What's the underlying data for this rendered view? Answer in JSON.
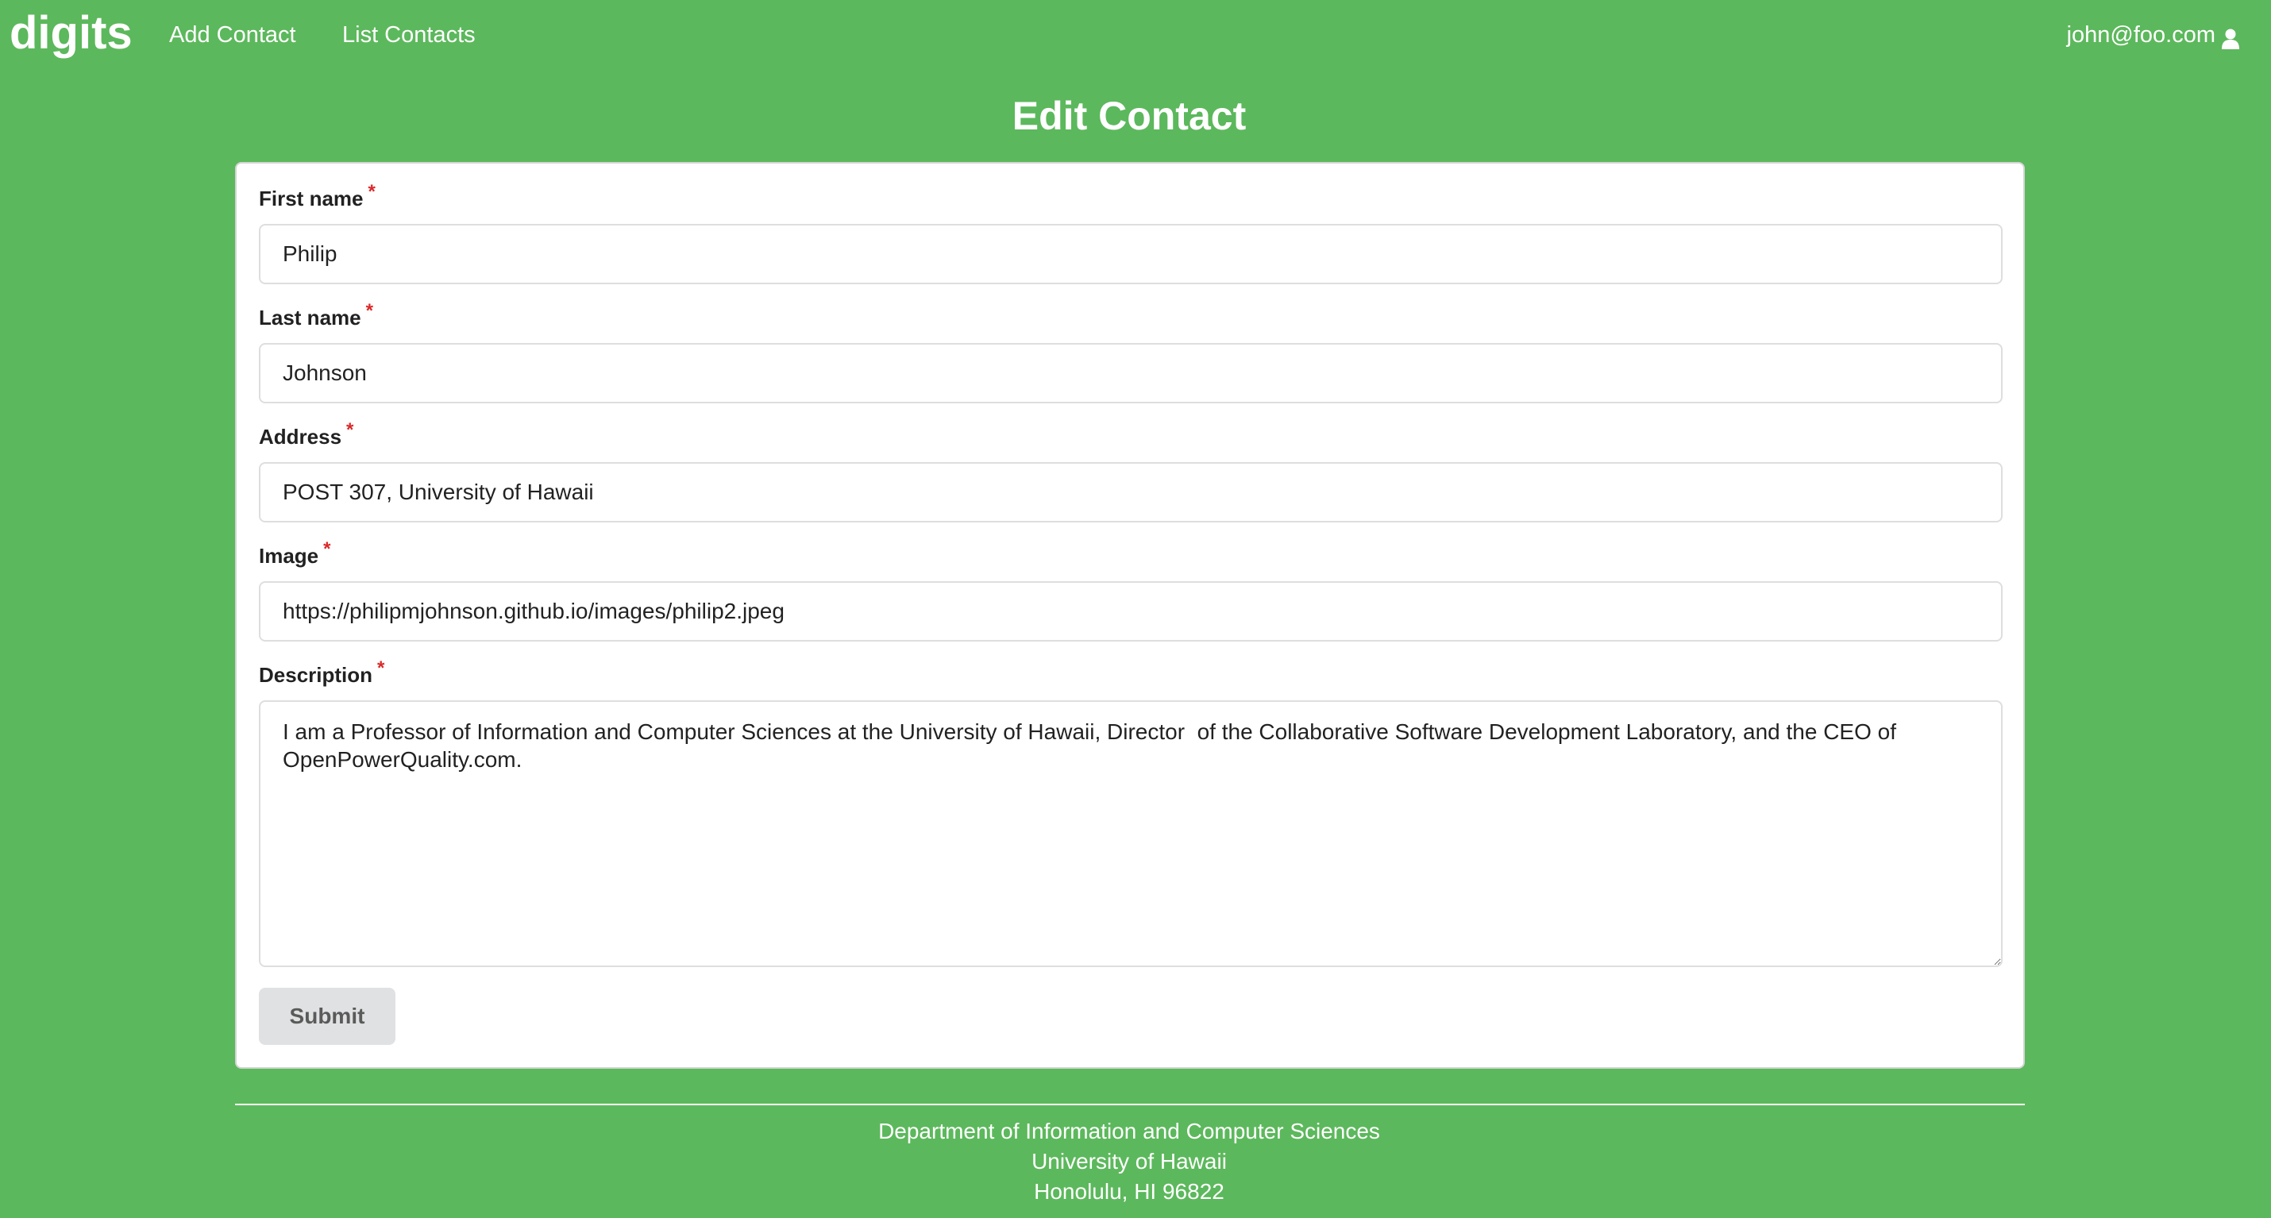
{
  "navbar": {
    "brand": "digits",
    "links": [
      "Add Contact",
      "List Contacts"
    ],
    "user_email": "john@foo.com",
    "user_icon": "user-icon"
  },
  "page": {
    "title": "Edit Contact"
  },
  "form": {
    "required_marker": "*",
    "fields": [
      {
        "label": "First name",
        "value": "Philip",
        "required": true
      },
      {
        "label": "Last name",
        "value": "Johnson",
        "required": true
      },
      {
        "label": "Address",
        "value": "POST 307, University of Hawaii",
        "required": true
      },
      {
        "label": "Image",
        "value": "https://philipmjohnson.github.io/images/philip2.jpeg",
        "required": true
      },
      {
        "label": "Description",
        "value": "I am a Professor of Information and Computer Sciences at the University of Hawaii, Director  of the Collaborative Software Development Laboratory, and the CEO of OpenPowerQuality.com.",
        "required": true
      }
    ],
    "submit_label": "Submit"
  },
  "footer": {
    "lines": [
      "Department of Information and Computer Sciences",
      "University of Hawaii",
      "Honolulu, HI 96822"
    ]
  },
  "colors": {
    "background": "#5cb85c",
    "card": "#ffffff",
    "required": "#db2828",
    "button": "#e0e1e2"
  }
}
